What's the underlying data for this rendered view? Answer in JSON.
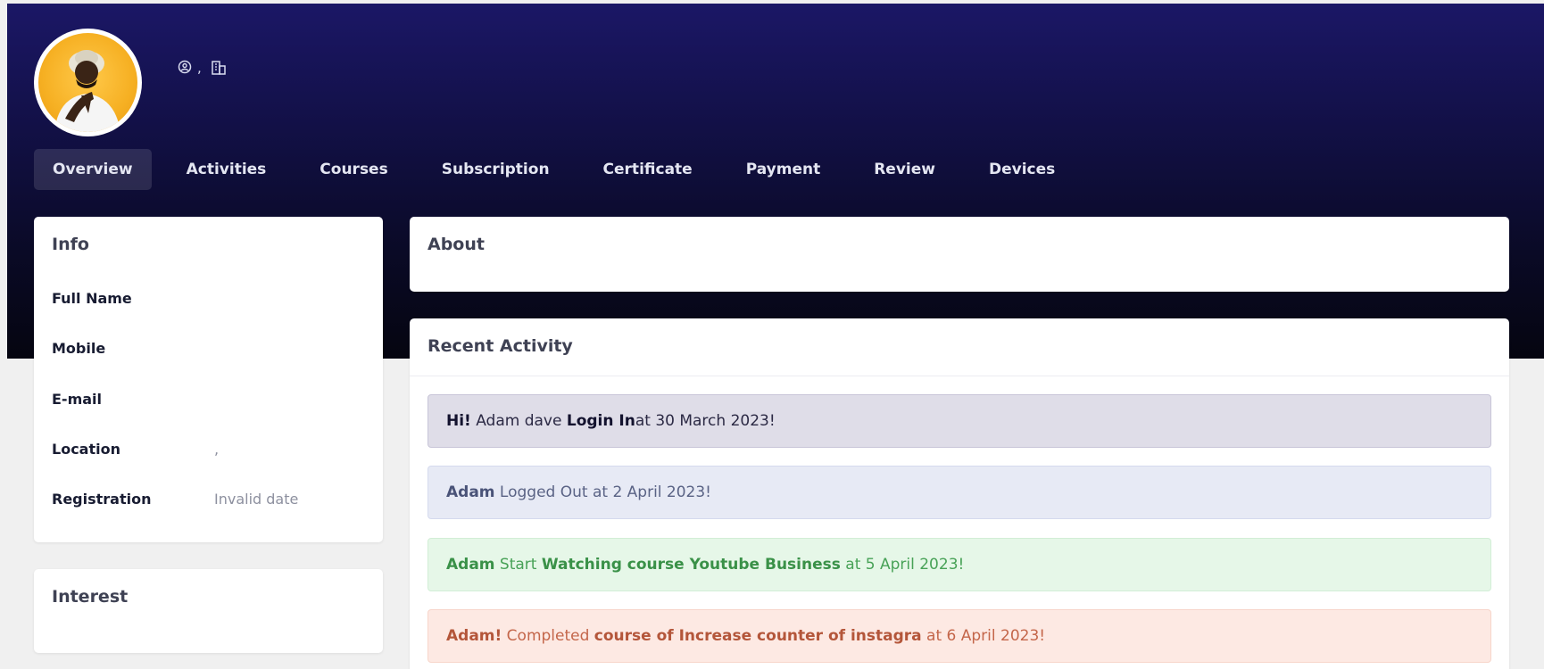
{
  "profile": {
    "avatar_alt": "avatar",
    "location_sep": ","
  },
  "tabs": [
    {
      "label": "Overview",
      "active": true
    },
    {
      "label": "Activities"
    },
    {
      "label": "Courses"
    },
    {
      "label": "Subscription"
    },
    {
      "label": "Certificate"
    },
    {
      "label": "Payment"
    },
    {
      "label": "Review"
    },
    {
      "label": "Devices"
    }
  ],
  "info": {
    "title": "Info",
    "rows": [
      {
        "label": "Full Name",
        "value": ""
      },
      {
        "label": "Mobile",
        "value": ""
      },
      {
        "label": "E-mail",
        "value": ""
      },
      {
        "label": "Location",
        "value": ","
      },
      {
        "label": "Registration",
        "value": "Invalid date"
      }
    ]
  },
  "interest": {
    "title": "Interest"
  },
  "about": {
    "title": "About"
  },
  "recent": {
    "title": "Recent Activity",
    "items": [
      {
        "b1": "Hi!",
        "t1": " Adam dave ",
        "b2": "Login In",
        "t2": "at 30 March 2023!"
      },
      {
        "b1": "Adam",
        "t1": " Logged Out at 2 April 2023!",
        "b2": "",
        "t2": ""
      },
      {
        "b1": "Adam",
        "t1": " Start ",
        "b2": "Watching course Youtube Business",
        "t2": " at 5 April 2023!"
      },
      {
        "b1": "Adam!",
        "t1": " Completed ",
        "b2": "course of Increase counter of instagra",
        "t2": " at 6 April 2023!"
      }
    ]
  },
  "icons": {
    "location": "location-pin-icon",
    "company": "building-icon"
  },
  "colors": {
    "hero_top": "#1b1766",
    "hero_bottom": "#050510",
    "alert_login": "#dfdde8",
    "alert_logout": "#e7eaf5",
    "alert_watch": "#e6f7e8",
    "alert_complete": "#fde9e3"
  }
}
